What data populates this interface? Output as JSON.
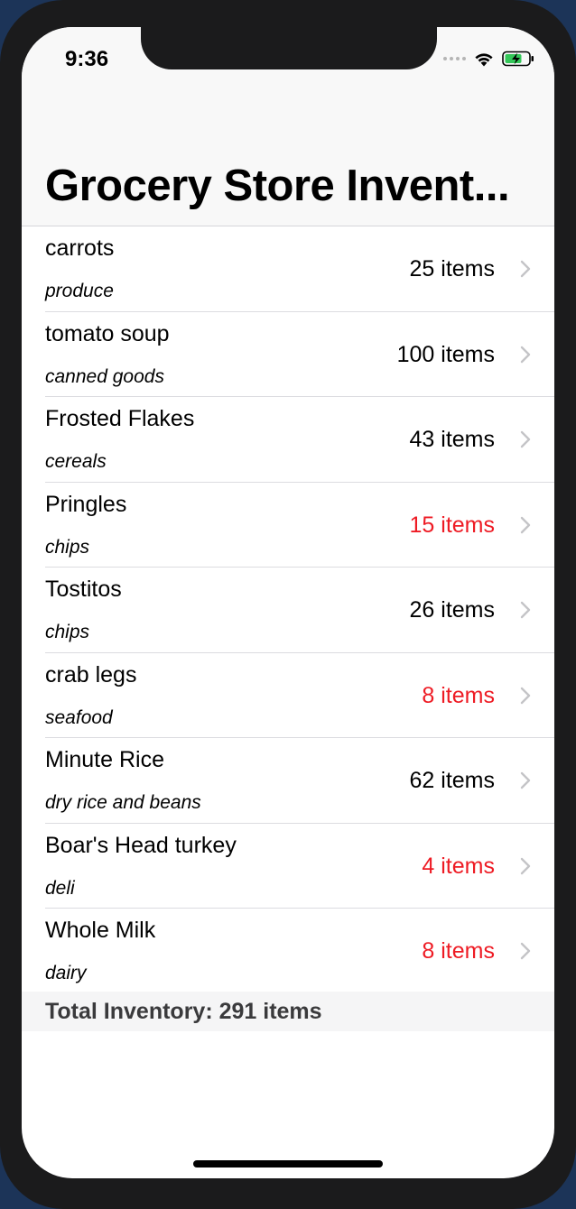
{
  "status_bar": {
    "time": "9:36"
  },
  "nav": {
    "title": "Grocery Store Invent..."
  },
  "items": [
    {
      "name": "carrots",
      "category": "produce",
      "count_label": "25 items",
      "low_stock": false
    },
    {
      "name": "tomato soup",
      "category": "canned goods",
      "count_label": "100 items",
      "low_stock": false
    },
    {
      "name": "Frosted Flakes",
      "category": "cereals",
      "count_label": "43 items",
      "low_stock": false
    },
    {
      "name": "Pringles",
      "category": "chips",
      "count_label": "15 items",
      "low_stock": true
    },
    {
      "name": "Tostitos",
      "category": "chips",
      "count_label": "26 items",
      "low_stock": false
    },
    {
      "name": "crab legs",
      "category": "seafood",
      "count_label": "8 items",
      "low_stock": true
    },
    {
      "name": "Minute Rice",
      "category": "dry rice and beans",
      "count_label": "62 items",
      "low_stock": false
    },
    {
      "name": "Boar's Head turkey",
      "category": "deli",
      "count_label": "4 items",
      "low_stock": true
    },
    {
      "name": "Whole Milk",
      "category": "dairy",
      "count_label": "8 items",
      "low_stock": true
    }
  ],
  "footer": {
    "total_label": "Total Inventory: 291 items"
  },
  "colors": {
    "low_stock": "#ee1b24",
    "chevron": "#c4c4c7",
    "battery": "#34c759"
  },
  "icons": {
    "row_accessory": "chevron-right-icon",
    "wifi": "wifi-icon",
    "battery": "battery-charging-icon"
  }
}
